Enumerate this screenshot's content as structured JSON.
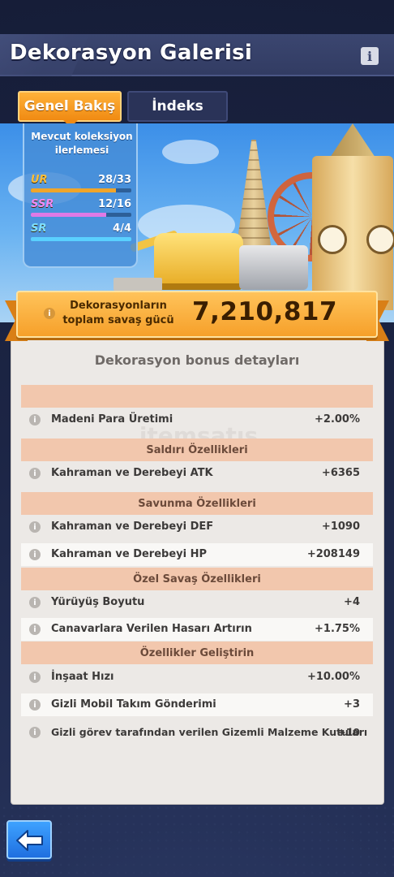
{
  "header": {
    "title": "Dekorasyon Galerisi",
    "info_icon": "info-icon"
  },
  "tabs": [
    {
      "label": "Genel Bakış",
      "active": true
    },
    {
      "label": "İndeks",
      "active": false
    }
  ],
  "progress": {
    "title": "Mevcut koleksiyon ilerlemesi",
    "rows": [
      {
        "rarity": "UR",
        "count": "28/33",
        "fraction": 0.848,
        "color": "#f0a52a"
      },
      {
        "rarity": "SSR",
        "count": "12/16",
        "fraction": 0.75,
        "color": "#e07ae6"
      },
      {
        "rarity": "SR",
        "count": "4/4",
        "fraction": 1.0,
        "color": "#5ad0ff"
      }
    ]
  },
  "power": {
    "label": "Dekorasyonların toplam savaş gücü",
    "value": "7,210,817"
  },
  "details": {
    "title": "Dekorasyon bonus detayları",
    "watermark": "itemsatış",
    "sections": [
      {
        "header": "",
        "rows": [
          {
            "name": "Madeni Para Üretimi",
            "value": "+2.00%"
          }
        ]
      },
      {
        "header": "Saldırı Özellikleri",
        "rows": [
          {
            "name": "Kahraman ve Derebeyi ATK",
            "value": "+6365"
          }
        ]
      },
      {
        "header": "Savunma Özellikleri",
        "rows": [
          {
            "name": "Kahraman ve Derebeyi DEF",
            "value": "+1090"
          },
          {
            "name": "Kahraman ve Derebeyi HP",
            "value": "+208149"
          }
        ]
      },
      {
        "header": "Özel Savaş Özellikleri",
        "rows": [
          {
            "name": "Yürüyüş Boyutu",
            "value": "+4"
          },
          {
            "name": "Canavarlara Verilen Hasarı Artırın",
            "value": "+1.75%"
          }
        ]
      },
      {
        "header": "Özellikler Geliştirin",
        "rows": [
          {
            "name": "İnşaat Hızı",
            "value": "+10.00%"
          },
          {
            "name": "Gizli Mobil Takım Gönderimi",
            "value": "+3"
          },
          {
            "name": "Gizli görev tarafından verilen Gizemli Malzeme Kutuları",
            "value": "+10"
          }
        ]
      }
    ]
  },
  "back_button": {
    "icon": "back-arrow-icon"
  }
}
